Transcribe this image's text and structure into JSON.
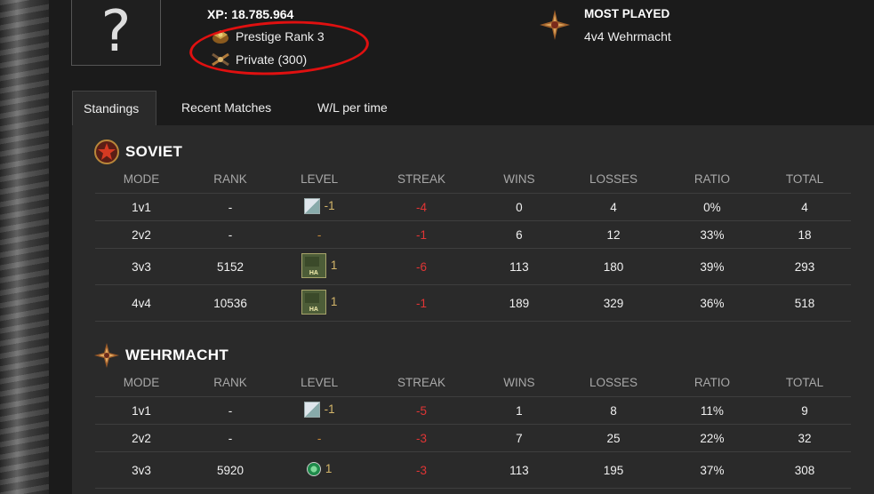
{
  "profile": {
    "xp_label": "XP: 18.785.964",
    "prestige": "Prestige Rank 3",
    "rank": "Private (300)",
    "avatar_glyph": "?"
  },
  "most_played": {
    "title": "MOST PLAYED",
    "value": "4v4 Wehrmacht"
  },
  "tabs": [
    {
      "label": "Standings",
      "active": true
    },
    {
      "label": "Recent Matches",
      "active": false
    },
    {
      "label": "W/L per time",
      "active": false
    }
  ],
  "columns": [
    "MODE",
    "RANK",
    "LEVEL",
    "STREAK",
    "WINS",
    "LOSSES",
    "RATIO",
    "TOTAL"
  ],
  "soviet": {
    "title": "SOVIET",
    "rows": [
      {
        "mode": "1v1",
        "rank": "-",
        "level_icon": "broken-image-icon",
        "level": "-1",
        "streak": "-4",
        "wins": "0",
        "losses": "4",
        "ratio": "0%",
        "total": "4"
      },
      {
        "mode": "2v2",
        "rank": "-",
        "level_icon": "",
        "level": "-",
        "streak": "-1",
        "wins": "6",
        "losses": "12",
        "ratio": "33%",
        "total": "18"
      },
      {
        "mode": "3v3",
        "rank": "5152",
        "level_icon": "rank-badge-icon",
        "badge_text": "HA",
        "level": "1",
        "streak": "-6",
        "wins": "113",
        "losses": "180",
        "ratio": "39%",
        "total": "293"
      },
      {
        "mode": "4v4",
        "rank": "10536",
        "level_icon": "rank-badge-icon",
        "badge_text": "HA",
        "level": "1",
        "streak": "-1",
        "wins": "189",
        "losses": "329",
        "ratio": "36%",
        "total": "518"
      }
    ]
  },
  "wehrmacht": {
    "title": "WEHRMACHT",
    "rows": [
      {
        "mode": "1v1",
        "rank": "-",
        "level_icon": "broken-image-icon",
        "level": "-1",
        "streak": "-5",
        "wins": "1",
        "losses": "8",
        "ratio": "11%",
        "total": "9"
      },
      {
        "mode": "2v2",
        "rank": "-",
        "level_icon": "",
        "level": "-",
        "streak": "-3",
        "wins": "7",
        "losses": "25",
        "ratio": "22%",
        "total": "32"
      },
      {
        "mode": "3v3",
        "rank": "5920",
        "level_icon": "round-badge-icon",
        "level": "1",
        "streak": "-3",
        "wins": "113",
        "losses": "195",
        "ratio": "37%",
        "total": "308"
      }
    ]
  },
  "colors": {
    "negative": "#e03535",
    "annotation_circle": "#e01010",
    "background": "#1b1b1b",
    "panel": "#2a2a2a"
  }
}
